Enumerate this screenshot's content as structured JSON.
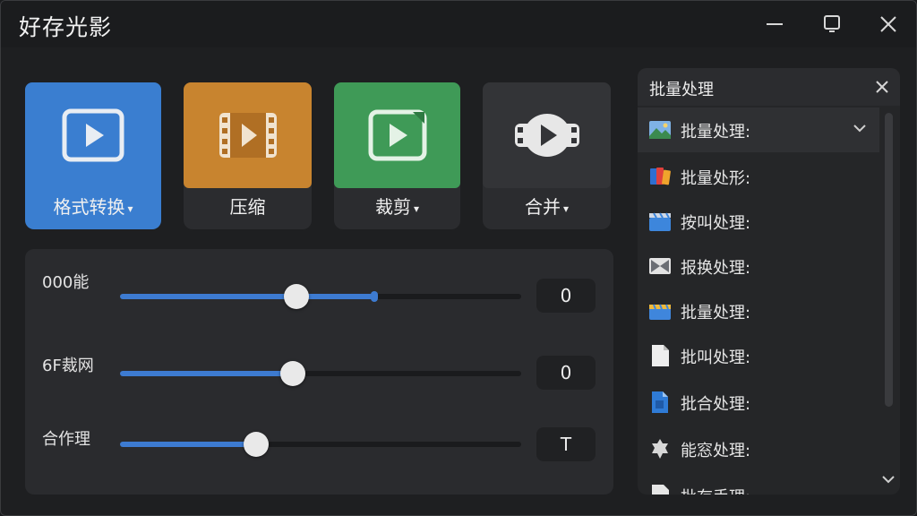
{
  "app": {
    "title": "好存光影"
  },
  "window_controls": [
    "minimize-icon",
    "maximize-icon",
    "close-icon"
  ],
  "tools": [
    {
      "label": "格式转换",
      "dropdown": true,
      "active": true,
      "icon": "video-play-icon",
      "color": "#3a7ed0"
    },
    {
      "label": "压缩",
      "dropdown": false,
      "active": false,
      "icon": "film-strip-icon",
      "color": "#c8842f"
    },
    {
      "label": "裁剪",
      "dropdown": true,
      "active": false,
      "icon": "crop-video-icon",
      "color": "#3f9a57"
    },
    {
      "label": "合并",
      "dropdown": true,
      "active": false,
      "icon": "merge-reel-icon",
      "color": "#2b2c2f"
    }
  ],
  "sliders": [
    {
      "label": "000能",
      "fraction": 0.44,
      "marker_fraction": 0.635,
      "value": "0"
    },
    {
      "label": "6F裁网",
      "fraction": 0.43,
      "value": "0"
    },
    {
      "label": "合作理",
      "fraction": 0.34,
      "value": "T"
    }
  ],
  "batch_panel": {
    "title": "批量处理",
    "items": [
      {
        "label": "批量处理:",
        "icon": "landscape-image-icon",
        "selected": true
      },
      {
        "label": "批量处形:",
        "icon": "color-books-icon",
        "selected": false
      },
      {
        "label": "按叫处理:",
        "icon": "clapper-icon",
        "selected": false
      },
      {
        "label": "报换处理:",
        "icon": "bowtie-icon",
        "selected": false
      },
      {
        "label": "批量处理:",
        "icon": "folder-icon",
        "selected": false
      },
      {
        "label": "批叫处理:",
        "icon": "document-icon",
        "selected": false
      },
      {
        "label": "批合处理:",
        "icon": "blue-file-icon",
        "selected": false
      },
      {
        "label": "能窓处理:",
        "icon": "gear-badge-icon",
        "selected": false
      },
      {
        "label": "批存手理:",
        "icon": "document-icon",
        "selected": false
      }
    ]
  },
  "colors": {
    "accent": "#3d7bd1",
    "background": "#1e1f21",
    "panel": "#2a2b2e"
  }
}
